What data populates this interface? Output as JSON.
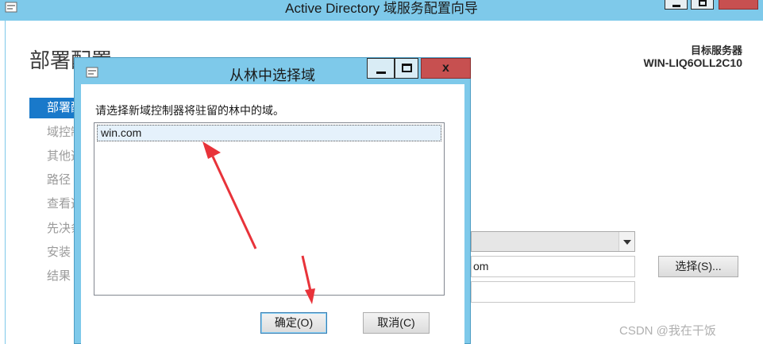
{
  "window": {
    "title": "Active Directory 域服务配置向导",
    "page_title": "部署配置",
    "target_label": "目标服务器",
    "target_server": "WIN-LIQ6OLL2C10"
  },
  "nav": {
    "items": [
      {
        "label": "部署配置",
        "active": true
      },
      {
        "label": "域控制器选项",
        "active": false
      },
      {
        "label": "其他选项",
        "active": false
      },
      {
        "label": "路径",
        "active": false
      },
      {
        "label": "查看选项",
        "active": false
      },
      {
        "label": "先决条件检查",
        "active": false
      },
      {
        "label": "安装",
        "active": false
      },
      {
        "label": "结果",
        "active": false
      }
    ]
  },
  "form": {
    "domain_value": "om",
    "select_button": "选择(S)..."
  },
  "dialog": {
    "title": "从林中选择域",
    "close_glyph": "x",
    "instruction": "请选择新域控制器将驻留的林中的域。",
    "items": [
      "win.com"
    ],
    "ok_label": "确定(O)",
    "cancel_label": "取消(C)"
  },
  "watermark": "CSDN @我在干饭",
  "colors": {
    "titlebar": "#7ec9ea",
    "nav_active": "#1979ca",
    "close_button": "#c75050",
    "annotation_arrow": "#e8333a"
  }
}
